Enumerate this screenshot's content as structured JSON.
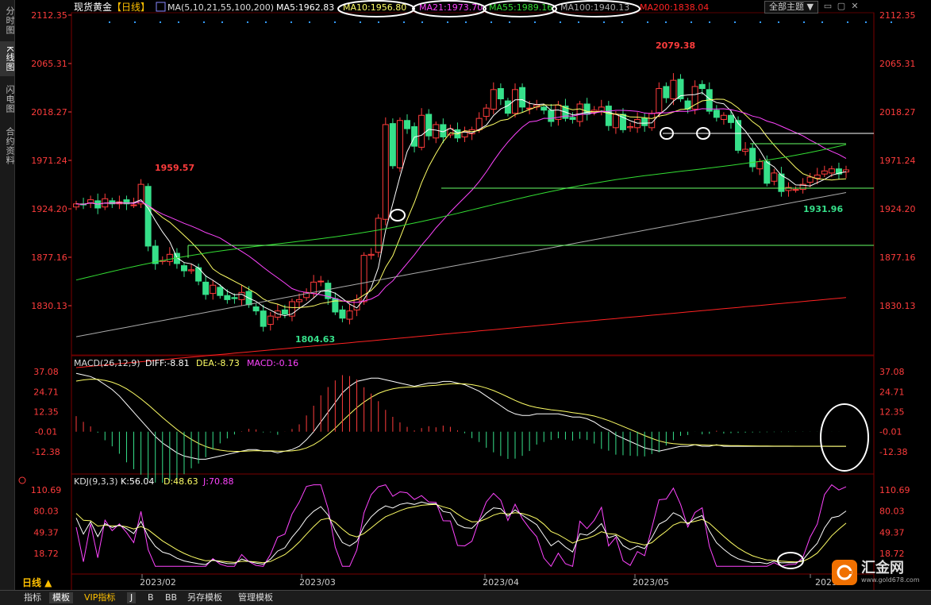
{
  "side_tabs": [
    "分时图",
    "K线图",
    "闪电图",
    "合约资料"
  ],
  "header": {
    "symbol": "现货黄金",
    "period_tag": "【日线】",
    "ma_title": "MA(5,10,21,55,100,200)",
    "ma5": "MA5:1962.83",
    "ma10": "MA10:1956.80",
    "ma21": "MA21:1973.70",
    "ma55": "MA55:1989.16",
    "ma100": "MA100:1940.13",
    "ma200": "MA200:1838.04",
    "theme_btn": "全部主题 ▼"
  },
  "colors": {
    "up": "#ff3c3c",
    "down": "#36e08a",
    "ma5": "#ffffff",
    "ma10": "#ffff66",
    "ma21": "#ff44ff",
    "ma55": "#33dd33",
    "ma100": "#aaaaaa",
    "ma200": "#ff2222",
    "axis": "#ff3c3c",
    "bg": "#000000"
  },
  "price_axis": [
    "2112.35",
    "2065.31",
    "2018.27",
    "1971.24",
    "1924.20",
    "1877.16",
    "1830.13"
  ],
  "annotations": {
    "high": "2079.38",
    "low": "1804.63",
    "left_high": "1959.57",
    "recent_low": "1931.96"
  },
  "macd": {
    "title": "MACD(26,12,9)",
    "diff": "DIFF:-8.81",
    "dea": "DEA:-8.73",
    "macd": "MACD:-0.16",
    "axis": [
      "37.08",
      "24.71",
      "12.35",
      "-0.01",
      "-12.38"
    ]
  },
  "kdj": {
    "title": "KDJ(9,3,3)",
    "k": "K:56.04",
    "d": "D:48.63",
    "j": "J:70.88",
    "axis": [
      "110.69",
      "80.03",
      "49.37",
      "18.72"
    ]
  },
  "x_labels": [
    "2023/02",
    "2023/03",
    "2023/04",
    "2023/05",
    "2023"
  ],
  "period": "日线 ▲",
  "bottom_tabs": [
    "指标",
    "模板",
    "VIP指标",
    "J",
    "B",
    "BB",
    "另存模板",
    "管理模板"
  ],
  "logo": {
    "name": "汇金网",
    "url": "www.gold678.com"
  },
  "chart_data": {
    "type": "candlestick",
    "title": "现货黄金 日线",
    "close_series_approx": [
      1929,
      1928,
      1933,
      1925,
      1934,
      1929,
      1931,
      1929,
      1928,
      1948,
      1888,
      1871,
      1874,
      1880,
      1871,
      1864,
      1865,
      1854,
      1841,
      1850,
      1840,
      1836,
      1837,
      1843,
      1831,
      1825,
      1810,
      1820,
      1825,
      1822,
      1834,
      1836,
      1843,
      1853,
      1854,
      1837,
      1824,
      1818,
      1825,
      1836,
      1879,
      1880,
      1915,
      2006,
      1966,
      2010,
      2002,
      1985,
      2015,
      1995,
      2006,
      1994,
      2002,
      1993,
      1999,
      2001,
      2012,
      2022,
      2040,
      2031,
      2017,
      2040,
      2023,
      2022,
      2025,
      2020,
      2009,
      2025,
      2012,
      2011,
      2026,
      2016,
      2020,
      2023,
      2005,
      2016,
      2001,
      2004,
      2011,
      2005,
      2017,
      2041,
      2032,
      2049,
      2031,
      2021,
      2043,
      2041,
      2019,
      2013,
      2015,
      2008,
      1981,
      1982,
      1965,
      1970,
      1949,
      1959,
      1941,
      1945,
      1943,
      1948,
      1955,
      1957,
      1961,
      1963,
      1958,
      1962
    ],
    "ma_latest": {
      "MA5": 1962.83,
      "MA10": 1956.8,
      "MA21": 1973.7,
      "MA55": 1989.16,
      "MA100": 1940.13,
      "MA200": 1838.04
    },
    "y_ticks": [
      2112.35,
      2065.31,
      2018.27,
      1971.24,
      1924.2,
      1877.16,
      1830.13
    ],
    "high": 2079.38,
    "low": 1804.63
  }
}
